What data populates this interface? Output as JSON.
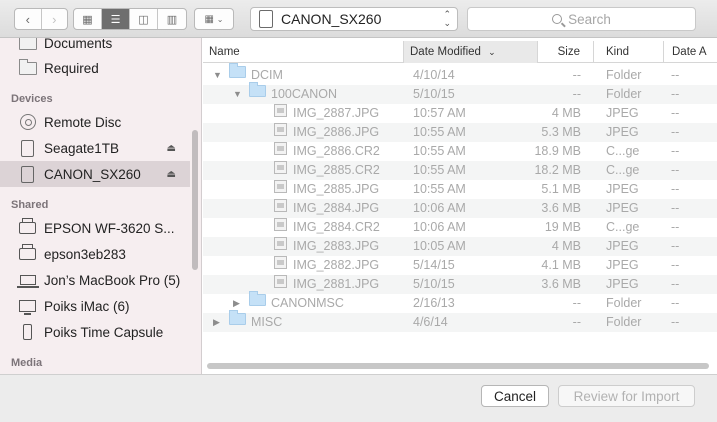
{
  "toolbar": {
    "location": "CANON_SX260",
    "search_placeholder": "Search"
  },
  "sidebar": {
    "favorites": [
      {
        "label": "Documents",
        "icon": "folder-icon"
      },
      {
        "label": "Required",
        "icon": "folder-icon"
      }
    ],
    "devices_heading": "Devices",
    "devices": [
      {
        "label": "Remote Disc",
        "icon": "disc-icon"
      },
      {
        "label": "Seagate1TB",
        "icon": "drive-icon",
        "eject": true
      },
      {
        "label": "CANON_SX260",
        "icon": "drive-icon",
        "eject": true,
        "selected": true
      }
    ],
    "shared_heading": "Shared",
    "shared": [
      {
        "label": "EPSON WF-3620 S...",
        "icon": "printer-icon"
      },
      {
        "label": "epson3eb283",
        "icon": "printer-icon"
      },
      {
        "label": "Jon’s MacBook Pro (5)",
        "icon": "laptop-icon"
      },
      {
        "label": "Poiks iMac (6)",
        "icon": "monitor-icon"
      },
      {
        "label": "Poiks Time Capsule",
        "icon": "capsule-icon"
      }
    ],
    "media_heading": "Media"
  },
  "columns": {
    "name": "Name",
    "date_modified": "Date Modified",
    "size": "Size",
    "kind": "Kind",
    "date_added": "Date A"
  },
  "rows": [
    {
      "name": "DCIM",
      "date": "4/10/14",
      "size": "--",
      "kind": "Folder",
      "added": "--",
      "level": 0,
      "type": "folder",
      "disclosure": "▼"
    },
    {
      "name": "100CANON",
      "date": "5/10/15",
      "size": "--",
      "kind": "Folder",
      "added": "--",
      "level": 1,
      "type": "folder",
      "disclosure": "▼"
    },
    {
      "name": "IMG_2887.JPG",
      "date": "10:57 AM",
      "size": "4 MB",
      "kind": "JPEG",
      "added": "--",
      "level": 2,
      "type": "file"
    },
    {
      "name": "IMG_2886.JPG",
      "date": "10:55 AM",
      "size": "5.3 MB",
      "kind": "JPEG",
      "added": "--",
      "level": 2,
      "type": "file"
    },
    {
      "name": "IMG_2886.CR2",
      "date": "10:55 AM",
      "size": "18.9 MB",
      "kind": "C...ge",
      "added": "--",
      "level": 2,
      "type": "file"
    },
    {
      "name": "IMG_2885.CR2",
      "date": "10:55 AM",
      "size": "18.2 MB",
      "kind": "C...ge",
      "added": "--",
      "level": 2,
      "type": "file"
    },
    {
      "name": "IMG_2885.JPG",
      "date": "10:55 AM",
      "size": "5.1 MB",
      "kind": "JPEG",
      "added": "--",
      "level": 2,
      "type": "file"
    },
    {
      "name": "IMG_2884.JPG",
      "date": "10:06 AM",
      "size": "3.6 MB",
      "kind": "JPEG",
      "added": "--",
      "level": 2,
      "type": "file"
    },
    {
      "name": "IMG_2884.CR2",
      "date": "10:06 AM",
      "size": "19 MB",
      "kind": "C...ge",
      "added": "--",
      "level": 2,
      "type": "file"
    },
    {
      "name": "IMG_2883.JPG",
      "date": "10:05 AM",
      "size": "4 MB",
      "kind": "JPEG",
      "added": "--",
      "level": 2,
      "type": "file"
    },
    {
      "name": "IMG_2882.JPG",
      "date": "5/14/15",
      "size": "4.1 MB",
      "kind": "JPEG",
      "added": "--",
      "level": 2,
      "type": "file"
    },
    {
      "name": "IMG_2881.JPG",
      "date": "5/10/15",
      "size": "3.6 MB",
      "kind": "JPEG",
      "added": "--",
      "level": 2,
      "type": "file"
    },
    {
      "name": "CANONMSC",
      "date": "2/16/13",
      "size": "--",
      "kind": "Folder",
      "added": "--",
      "level": 1,
      "type": "folder",
      "disclosure": "▶"
    },
    {
      "name": "MISC",
      "date": "4/6/14",
      "size": "--",
      "kind": "Folder",
      "added": "--",
      "level": 0,
      "type": "folder",
      "disclosure": "▶"
    }
  ],
  "buttons": {
    "cancel": "Cancel",
    "review": "Review for Import"
  }
}
